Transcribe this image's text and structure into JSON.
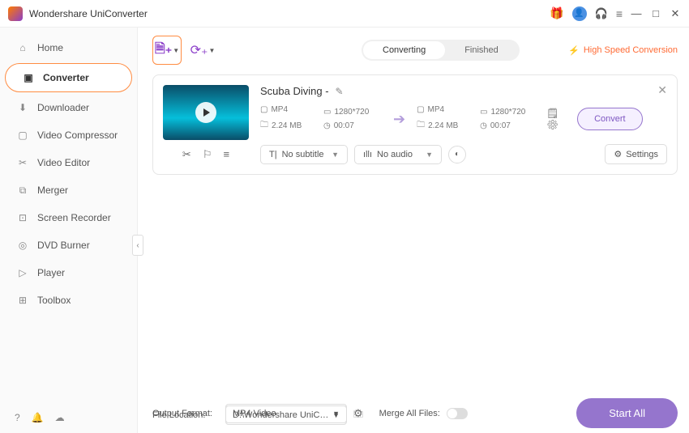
{
  "app": {
    "title": "Wondershare UniConverter"
  },
  "sidebar": {
    "items": [
      {
        "label": "Home"
      },
      {
        "label": "Converter"
      },
      {
        "label": "Downloader"
      },
      {
        "label": "Video Compressor"
      },
      {
        "label": "Video Editor"
      },
      {
        "label": "Merger"
      },
      {
        "label": "Screen Recorder"
      },
      {
        "label": "DVD Burner"
      },
      {
        "label": "Player"
      },
      {
        "label": "Toolbox"
      }
    ]
  },
  "tabs": {
    "converting": "Converting",
    "finished": "Finished"
  },
  "hsc": "High Speed Conversion",
  "file": {
    "title": "Scuba Diving -",
    "src": {
      "format": "MP4",
      "resolution": "1280*720",
      "size": "2.24 MB",
      "duration": "00:07"
    },
    "dst": {
      "format": "MP4",
      "resolution": "1280*720",
      "size": "2.24 MB",
      "duration": "00:07"
    },
    "subtitle": "No subtitle",
    "audio": "No audio",
    "settings": "Settings",
    "convert": "Convert"
  },
  "bottom": {
    "output_format_label": "Output Format:",
    "output_format": "MP4 Video",
    "file_location_label": "File Location:",
    "file_location": "D:\\Wondershare UniConverter",
    "merge_label": "Merge All Files:",
    "start_all": "Start All"
  }
}
